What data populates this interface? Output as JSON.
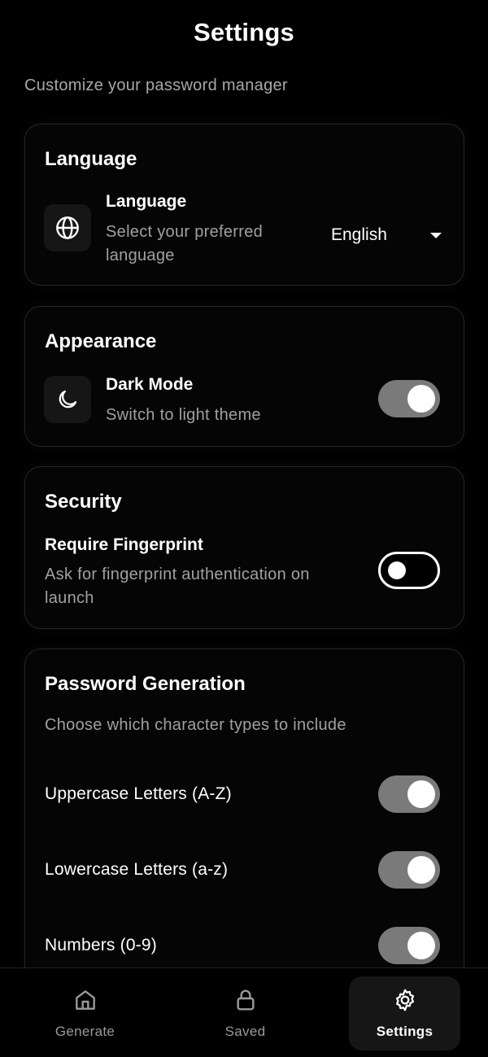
{
  "header": {
    "title": "Settings"
  },
  "subtitle": "Customize your password manager",
  "language_card": {
    "title": "Language",
    "row_title": "Language",
    "row_desc_line1": "Select your preferred",
    "row_desc_line2": "language",
    "selected": "English",
    "icon": "globe-icon"
  },
  "appearance_card": {
    "title": "Appearance",
    "row_title": "Dark Mode",
    "row_desc": "Switch to light theme",
    "toggle_on": true,
    "icon": "moon-icon"
  },
  "security_card": {
    "title": "Security",
    "row_title": "Require Fingerprint",
    "row_desc_line1": "Ask for fingerprint authentication on",
    "row_desc_line2": "launch",
    "toggle_on": false
  },
  "password_card": {
    "title": "Password Generation",
    "desc": "Choose which character types to include",
    "options": [
      {
        "label": "Uppercase Letters (A-Z)",
        "on": true
      },
      {
        "label": "Lowercase Letters (a-z)",
        "on": true
      },
      {
        "label": "Numbers (0-9)",
        "on": true
      }
    ]
  },
  "nav": {
    "items": [
      {
        "label": "Generate",
        "icon": "home-icon",
        "active": false
      },
      {
        "label": "Saved",
        "icon": "lock-icon",
        "active": false
      },
      {
        "label": "Settings",
        "icon": "gear-icon",
        "active": true
      }
    ]
  }
}
